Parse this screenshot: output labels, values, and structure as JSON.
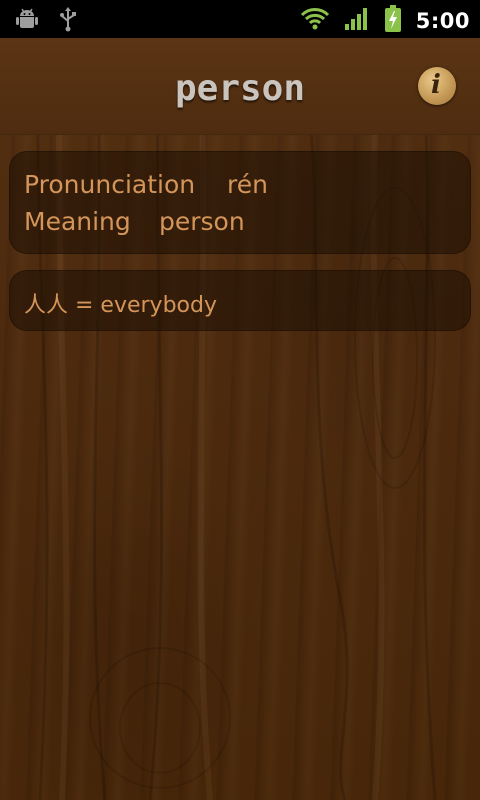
{
  "status_bar": {
    "time": "5:00",
    "left_icons": [
      "android-debug-icon",
      "usb-icon"
    ],
    "right_icons": [
      "wifi-icon",
      "signal-icon",
      "battery-charging-icon"
    ]
  },
  "header": {
    "title": "person",
    "info_button_glyph": "i"
  },
  "details": {
    "pronunciation_label": "Pronunciation",
    "pronunciation_value": "rén",
    "meaning_label": "Meaning",
    "meaning_value": "person"
  },
  "example": {
    "text": "人人 = everybody"
  },
  "colors": {
    "accent_text": "#d4955a",
    "title_text": "#c9c4bd",
    "wood": "#4d2a0e",
    "status_icons": "#8bc34a"
  }
}
